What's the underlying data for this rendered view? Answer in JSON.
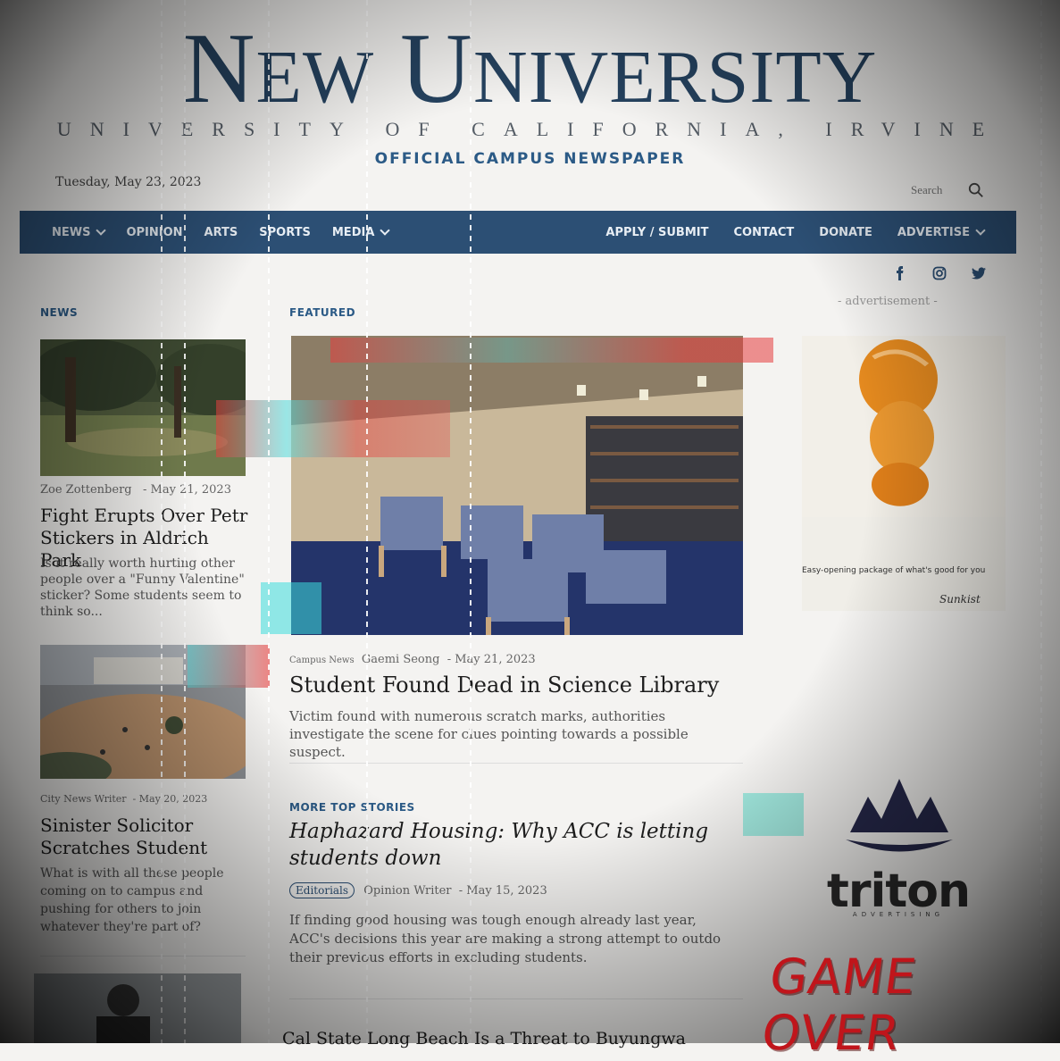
{
  "masthead": {
    "title_first_initial": "N",
    "title_first_rest": "EW",
    "title_second_initial": "U",
    "title_second_rest": "NIVERSITY",
    "subtitle": "UNIVERSITY OF CALIFORNIA, IRVINE",
    "tagline": "OFFICIAL CAMPUS NEWSPAPER"
  },
  "header": {
    "date": "Tuesday, May 23, 2023",
    "search_placeholder": "Search"
  },
  "nav": {
    "left": [
      {
        "label": "NEWS",
        "dropdown": true
      },
      {
        "label": "OPINION",
        "dropdown": false
      },
      {
        "label": "ARTS",
        "dropdown": false
      },
      {
        "label": "SPORTS",
        "dropdown": false
      },
      {
        "label": "MEDIA",
        "dropdown": true
      }
    ],
    "right": [
      {
        "label": "APPLY / SUBMIT",
        "dropdown": false
      },
      {
        "label": "CONTACT",
        "dropdown": false
      },
      {
        "label": "DONATE",
        "dropdown": false
      },
      {
        "label": "ADVERTISE",
        "dropdown": true
      }
    ]
  },
  "social": [
    "facebook-icon",
    "instagram-icon",
    "twitter-icon"
  ],
  "news": {
    "label": "NEWS",
    "articles": [
      {
        "author": "Zoe Zottenberg",
        "date": "May 21, 2023",
        "title": "Fight Erupts Over Petr Stickers in Aldrich Park",
        "excerpt": "Is it really worth hurting other people over a \"Funny Valentine\" sticker? Some students seem to think so..."
      },
      {
        "author": "City News Writer",
        "date": "May 20, 2023",
        "title": "Sinister Solicitor Scratches Student",
        "excerpt": "What is with all these people coming on to campus and pushing for others to join whatever they're part of?"
      }
    ]
  },
  "featured": {
    "label": "FEATURED",
    "category": "Campus News",
    "author": "Gaemi Seong",
    "date": "May 21, 2023",
    "title": "Student Found Dead in Science Library",
    "excerpt": "Victim found with numerous scratch marks, authorities investigate the scene for clues pointing towards a possible suspect."
  },
  "more_top_stories": {
    "label": "MORE TOP STORIES",
    "title": "Haphazard Housing: Why ACC is letting students down",
    "tag": "Editorials",
    "author": "Opinion Writer",
    "date": "May 15, 2023",
    "excerpt": "If finding good housing was tough enough already last year, ACC's decisions this year are making a strong attempt to outdo their previous efforts in excluding students.",
    "next_title": "Cal State Long Beach Is a Threat to Buyungwa"
  },
  "ad": {
    "label": "- advertisement -",
    "caption": "Easy-opening package of what's good for you",
    "brand": "Sunkist"
  },
  "triton": {
    "name": "triton",
    "sub": "ADVERTISING"
  },
  "overlay": {
    "game_over": "GAME OVER"
  },
  "colors": {
    "nav_bg": "#2c4f74",
    "brand_blue": "#25425f",
    "accent": "#2b5a86",
    "game_over_red": "#c0151b"
  }
}
